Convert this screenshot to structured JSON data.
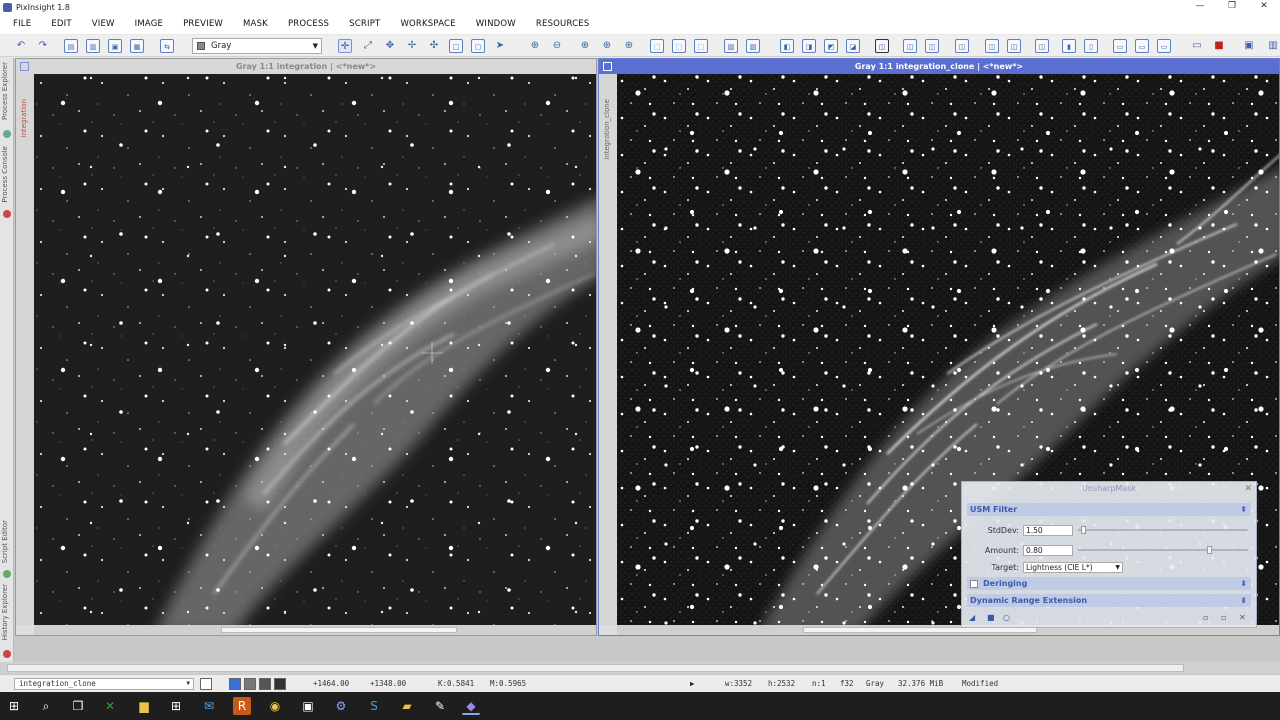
{
  "app": {
    "title": "PixInsight 1.8",
    "window_controls": [
      "—",
      "❐",
      "✕"
    ]
  },
  "menu": [
    "FILE",
    "EDIT",
    "VIEW",
    "IMAGE",
    "PREVIEW",
    "MASK",
    "PROCESS",
    "SCRIPT",
    "WORKSPACE",
    "WINDOW",
    "RESOURCES"
  ],
  "toolbar": {
    "channel_combo": "Gray"
  },
  "left_tabs": [
    "Process Explorer",
    "Process Console",
    "Script Editor",
    "History Explorer"
  ],
  "windows": {
    "left": {
      "title": "Gray 1:1 integration | <*new*>",
      "side_label": "integration"
    },
    "right": {
      "title": "Gray 1:1 integration_clone | <*new*>",
      "side_label": "integration_clone"
    }
  },
  "usm": {
    "title": "UnsharpMask",
    "sections": {
      "filter": "USM Filter",
      "deringing": "Deringing",
      "dre": "Dynamic Range Extension"
    },
    "stddev_label": "StdDev:",
    "stddev": "1.50",
    "stddev_level": 0.02,
    "amount_label": "Amount:",
    "amount": "0.80",
    "amount_level": 0.78,
    "target_label": "Target:",
    "target": "Lightness (CIE L*)",
    "deringing_checked": false
  },
  "status": {
    "view": "integration_clone",
    "cursor_x": "+1464.00",
    "cursor_y": "+1348.00",
    "k": "K:0.5841",
    "m": "M:0.5965",
    "width": "w:3352",
    "height": "h:2532",
    "channels": "n:1",
    "depth": "f32",
    "colorspace": "Gray",
    "size": "32.376 MiB",
    "state": "Modified"
  },
  "colors": {
    "active_title": "#5b6fd2",
    "accent": "#3d62a8",
    "taskbar": "#1e1e1e"
  }
}
